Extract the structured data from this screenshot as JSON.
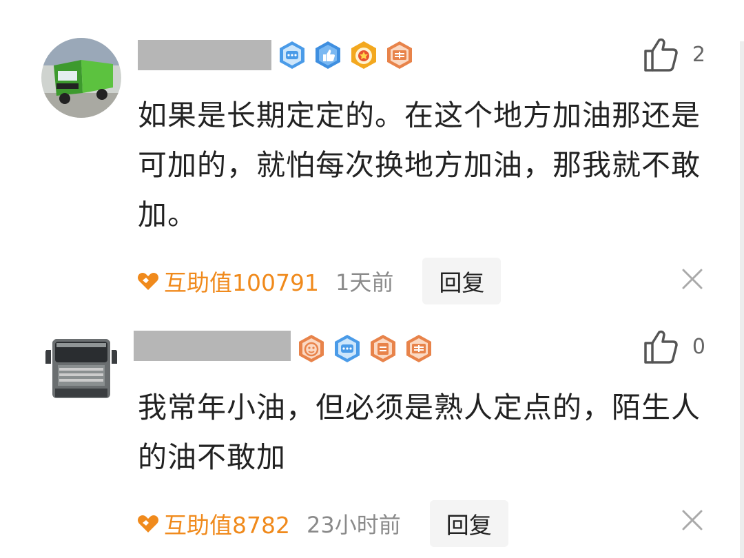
{
  "comments": [
    {
      "likes": "2",
      "text": "如果是长期定定的。在这个地方加油那还是可加的，就怕每次换地方加油，那我就不敢加。",
      "help_label": "互助值100791",
      "time": "1天前",
      "reply_label": "回复",
      "badges": [
        "chat-badge",
        "thumb-badge",
        "medal-badge",
        "card-badge"
      ]
    },
    {
      "likes": "0",
      "text": "我常年小油，但必须是熟人定点的，陌生人的油不敢加",
      "help_label": "互助值8782",
      "time": "23小时前",
      "reply_label": "回复",
      "badges": [
        "smile-badge",
        "chat-badge",
        "calendar-badge",
        "card-badge"
      ]
    }
  ],
  "colors": {
    "accent_orange": "#f08a1c",
    "badge_blue": "#4a9be8",
    "badge_orange": "#e8834a"
  }
}
